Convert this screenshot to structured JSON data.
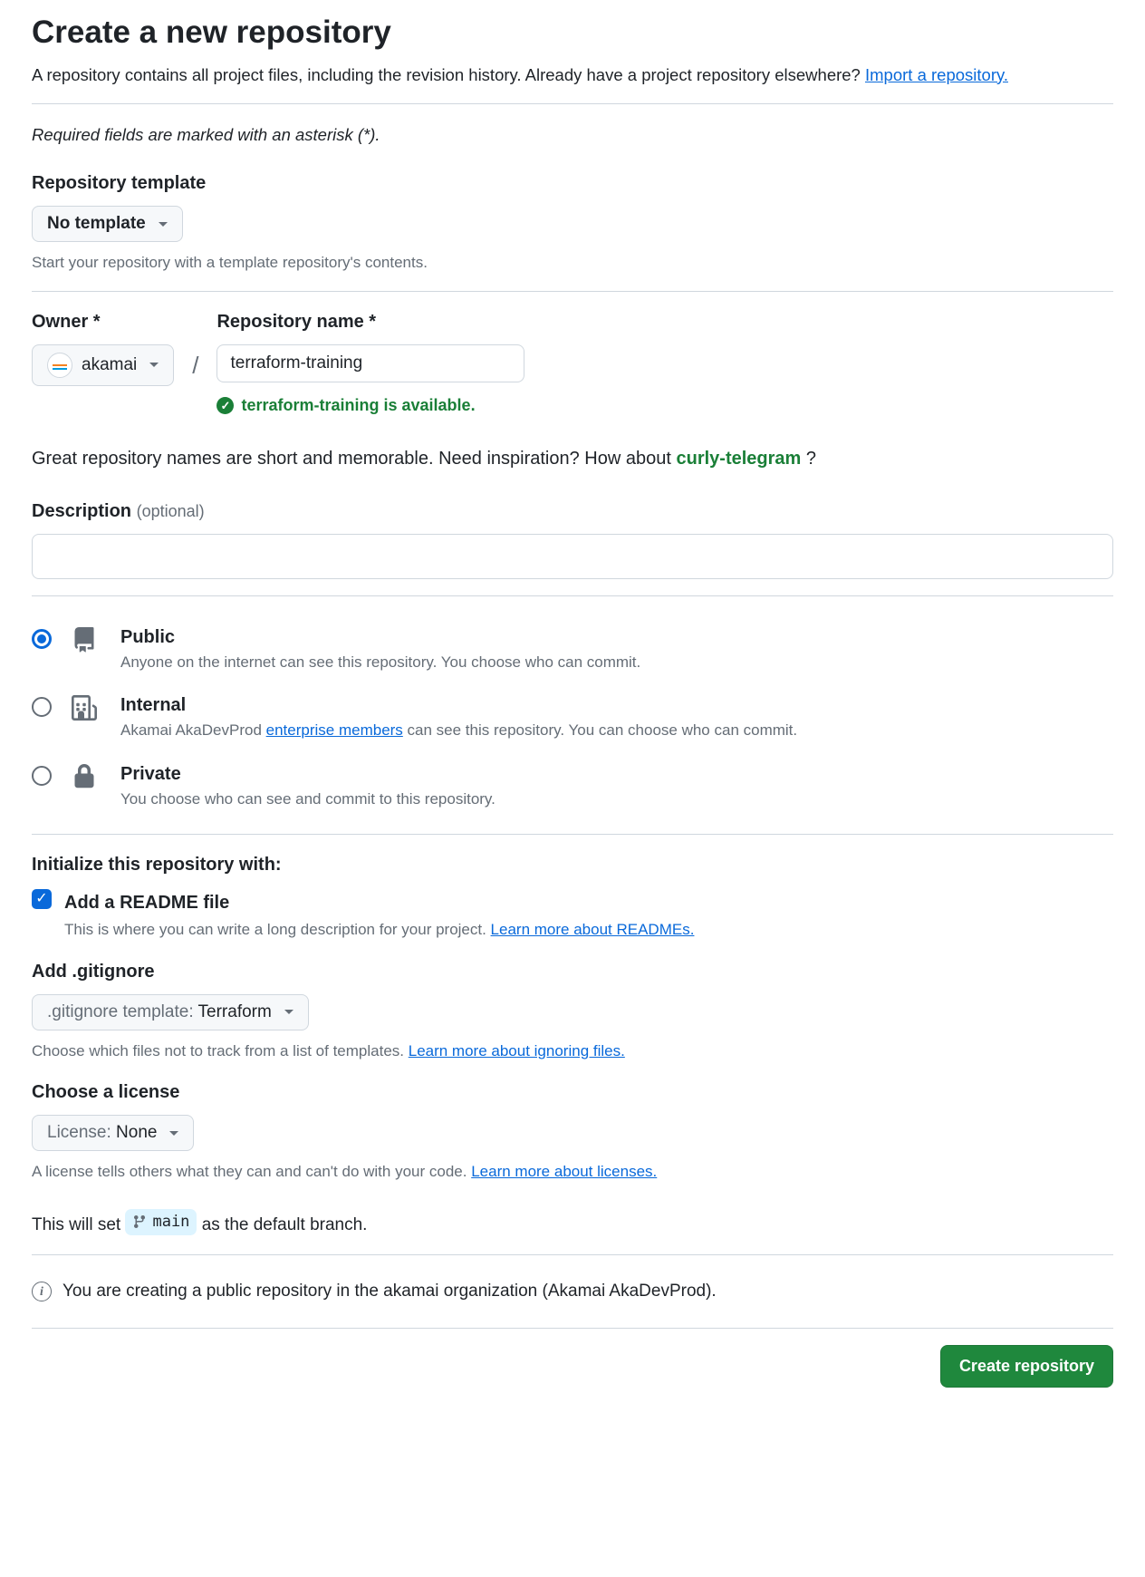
{
  "header": {
    "title": "Create a new repository",
    "subtitle_part1": "A repository contains all project files, including the revision history. Already have a project repository elsewhere? ",
    "import_link": "Import a repository.",
    "required_note": "Required fields are marked with an asterisk (*)."
  },
  "template": {
    "label": "Repository template",
    "value": "No template",
    "hint": "Start your repository with a template repository's contents."
  },
  "owner": {
    "label": "Owner *",
    "value": "akamai"
  },
  "repo_name": {
    "label": "Repository name *",
    "value": "terraform-training",
    "available_msg": "terraform-training is available."
  },
  "inspire": {
    "text_part1": "Great repository names are short and memorable. Need inspiration? How about ",
    "suggestion": "curly-telegram",
    "text_part2": " ?"
  },
  "description": {
    "label": "Description ",
    "optional": "(optional)",
    "value": ""
  },
  "visibility": {
    "public": {
      "title": "Public",
      "desc": "Anyone on the internet can see this repository. You choose who can commit."
    },
    "internal": {
      "title": "Internal",
      "desc_prefix": "Akamai AkaDevProd ",
      "desc_link": "enterprise members",
      "desc_suffix": " can see this repository. You can choose who can commit."
    },
    "private": {
      "title": "Private",
      "desc": "You choose who can see and commit to this repository."
    }
  },
  "initialize": {
    "label": "Initialize this repository with:",
    "readme_title": "Add a README file",
    "readme_desc_text": "This is where you can write a long description for your project. ",
    "readme_link": "Learn more about READMEs."
  },
  "gitignore": {
    "label": "Add .gitignore",
    "prefix": ".gitignore template: ",
    "value": "Terraform",
    "hint_text": "Choose which files not to track from a list of templates. ",
    "hint_link": "Learn more about ignoring files."
  },
  "license": {
    "label": "Choose a license",
    "prefix": "License: ",
    "value": "None",
    "hint_text": "A license tells others what they can and can't do with your code. ",
    "hint_link": "Learn more about licenses."
  },
  "branch": {
    "prefix": "This will set ",
    "name": "main",
    "suffix": " as the default branch."
  },
  "info": {
    "text": "You are creating a public repository in the akamai organization (Akamai AkaDevProd)."
  },
  "actions": {
    "create": "Create repository"
  }
}
